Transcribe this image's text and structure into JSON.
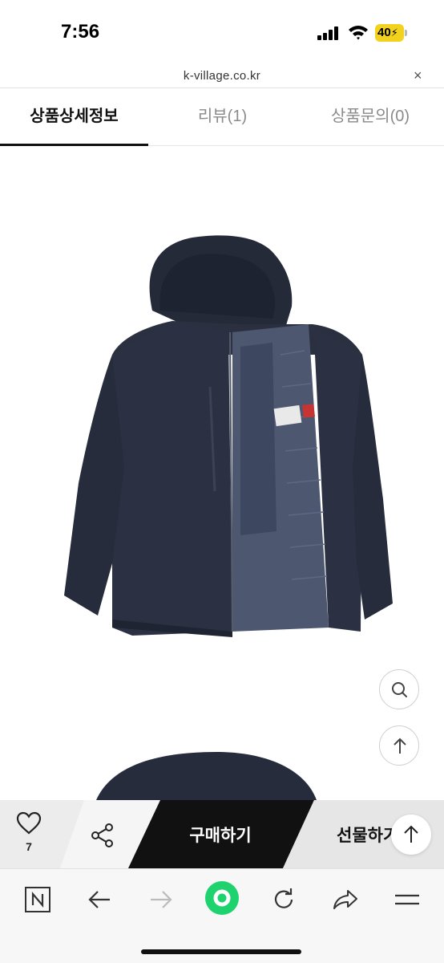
{
  "status_bar": {
    "time": "7:56",
    "battery_level": "40",
    "icons": [
      "signal-icon",
      "wifi-icon",
      "battery-charging-icon"
    ]
  },
  "url_bar": {
    "url": "k-village.co.kr",
    "close_label": "×"
  },
  "tabs": [
    {
      "label": "상품상세정보",
      "active": true
    },
    {
      "label": "리뷰(1)",
      "active": false
    },
    {
      "label": "상품문의(0)",
      "active": false
    }
  ],
  "product": {
    "image_icon": "navy-hooded-jacket-image",
    "zoom_icon": "search-icon",
    "scroll_top_icon": "arrow-up-icon"
  },
  "buy_bar": {
    "like_count": "7",
    "buy_label": "구매하기",
    "gift_label": "선물하기",
    "colors": {
      "buy": "#111111",
      "bar": "#efefef"
    }
  },
  "toolbar": {
    "icons": [
      "naver-n-icon",
      "back-arrow-icon",
      "forward-arrow-icon",
      "green-home-icon",
      "refresh-icon",
      "share-icon",
      "menu-icon"
    ],
    "accent": "#1ed36e"
  }
}
